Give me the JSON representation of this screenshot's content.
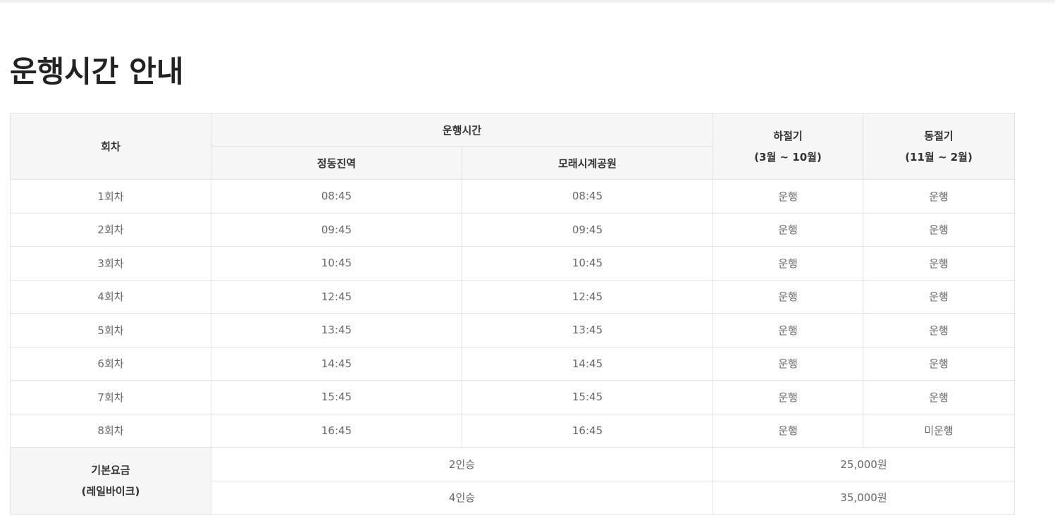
{
  "page": {
    "title": "운행시간 안내"
  },
  "table": {
    "header": {
      "round": "회차",
      "operating_time": "운행시간",
      "station_a": "정동진역",
      "station_b": "모래시계공원",
      "summer_name": "하절기",
      "summer_range": "(3월 ~ 10월)",
      "winter_name": "동절기",
      "winter_range": "(11월 ~ 2월)"
    },
    "rows": [
      {
        "round": "1회차",
        "a": "08:45",
        "b": "08:45",
        "summer": "운행",
        "winter": "운행"
      },
      {
        "round": "2회차",
        "a": "09:45",
        "b": "09:45",
        "summer": "운행",
        "winter": "운행"
      },
      {
        "round": "3회차",
        "a": "10:45",
        "b": "10:45",
        "summer": "운행",
        "winter": "운행"
      },
      {
        "round": "4회차",
        "a": "12:45",
        "b": "12:45",
        "summer": "운행",
        "winter": "운행"
      },
      {
        "round": "5회차",
        "a": "13:45",
        "b": "13:45",
        "summer": "운행",
        "winter": "운행"
      },
      {
        "round": "6회차",
        "a": "14:45",
        "b": "14:45",
        "summer": "운행",
        "winter": "운행"
      },
      {
        "round": "7회차",
        "a": "15:45",
        "b": "15:45",
        "summer": "운행",
        "winter": "운행"
      },
      {
        "round": "8회차",
        "a": "16:45",
        "b": "16:45",
        "summer": "운행",
        "winter": "미운행"
      }
    ],
    "fee": {
      "title": "기본요금",
      "subtitle": "(레일바이크)",
      "options": [
        {
          "type": "2인승",
          "price": "25,000원"
        },
        {
          "type": "4인승",
          "price": "35,000원"
        }
      ]
    }
  }
}
